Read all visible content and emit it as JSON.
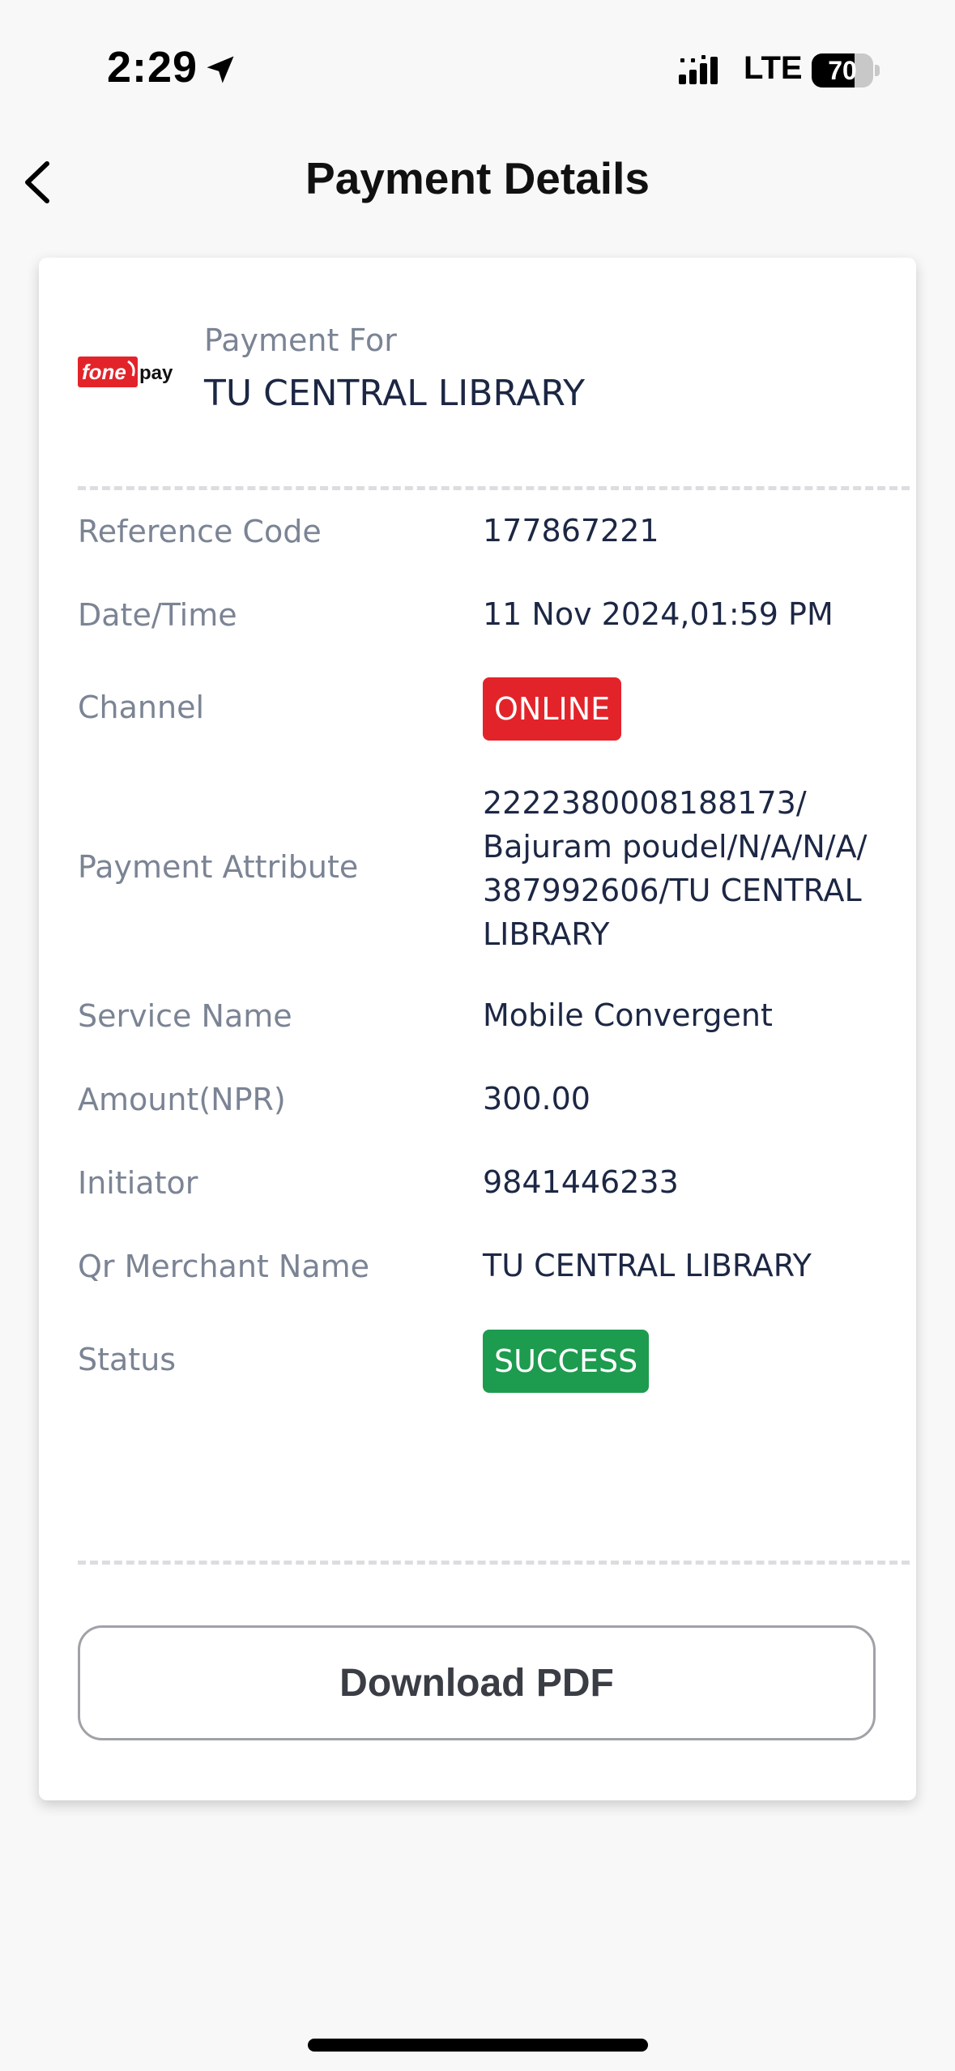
{
  "status_bar": {
    "time": "2:29",
    "carrier": "LTE",
    "battery": "70",
    "battery_level": 0.7
  },
  "header": {
    "title": "Payment Details"
  },
  "payment": {
    "logo_text": "fonepay",
    "payment_for_label": "Payment For",
    "payment_for_value": "TU CENTRAL LIBRARY"
  },
  "details": [
    {
      "label": "Reference Code",
      "value": "177867221"
    },
    {
      "label": "Date/Time",
      "value": "11 Nov 2024,01:59 PM"
    },
    {
      "label": "Channel",
      "value": "ONLINE"
    },
    {
      "label": "Payment Attribute",
      "value_lines": [
        "2222380008188173/",
        "Bajuram poudel/N/A/N/A/",
        "387992606/TU CENTRAL",
        "LIBRARY"
      ]
    },
    {
      "label": "Service Name",
      "value": "Mobile Convergent"
    },
    {
      "label": "Amount(NPR)",
      "value": "300.00"
    },
    {
      "label": "Initiator",
      "value": "9841446233"
    },
    {
      "label": "Qr Merchant Name",
      "value": "TU CENTRAL LIBRARY"
    },
    {
      "label": "Status",
      "value": "SUCCESS"
    }
  ],
  "actions": {
    "download_label": "Download PDF"
  },
  "colors": {
    "online_badge": "#e3232a",
    "success_badge": "#1d9b4f",
    "label_text": "#7b8494",
    "value_text": "#1c2744"
  }
}
